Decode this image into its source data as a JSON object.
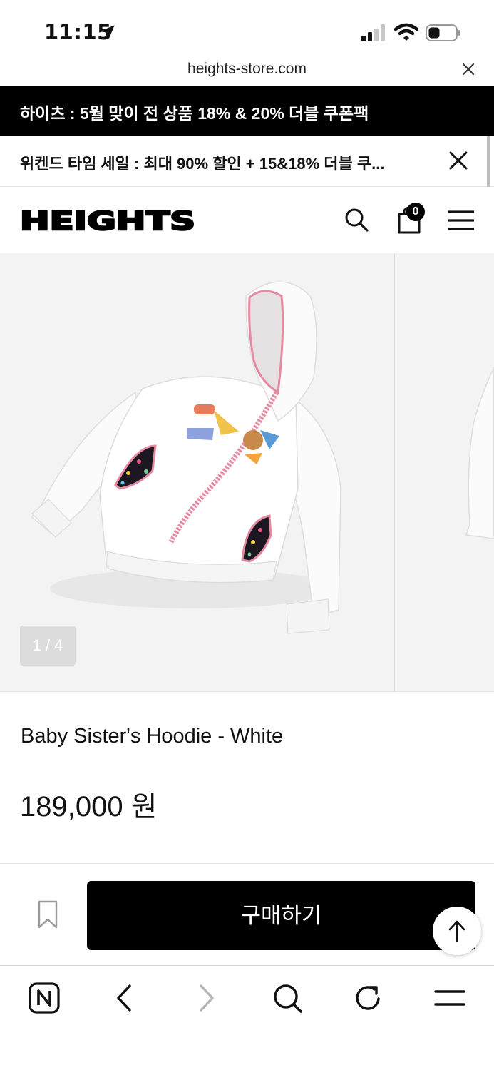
{
  "status_bar": {
    "time": "11:15"
  },
  "browser": {
    "url": "heights-store.com"
  },
  "promos": {
    "primary": "하이츠 : 5월 맞이 전 상품 18% & 20% 더블 쿠폰팩",
    "secondary": "위켄드 타임 세일 : 최대 90% 할인 + 15&18% 더블 쿠..."
  },
  "header": {
    "logo": "HEIGHTS",
    "cart_count": "0"
  },
  "gallery": {
    "counter": "1 / 4"
  },
  "product": {
    "title": "Baby Sister's Hoodie - White",
    "price": "189,000 원"
  },
  "actions": {
    "buy_label": "구매하기"
  },
  "icons": {
    "location": "location-arrow-icon",
    "signal": "cellular-signal-icon",
    "wifi": "wifi-icon",
    "battery": "battery-icon",
    "search": "search-icon",
    "cart": "shopping-bag-icon",
    "menu": "hamburger-menu-icon",
    "bookmark": "bookmark-icon",
    "top": "arrow-up-icon",
    "naver": "n-home-icon",
    "back": "chevron-left-icon",
    "forward": "chevron-right-icon",
    "refresh": "refresh-icon"
  },
  "colors": {
    "brand": "#000000",
    "background": "#ffffff",
    "gallery_bg": "#f3f3f3"
  }
}
